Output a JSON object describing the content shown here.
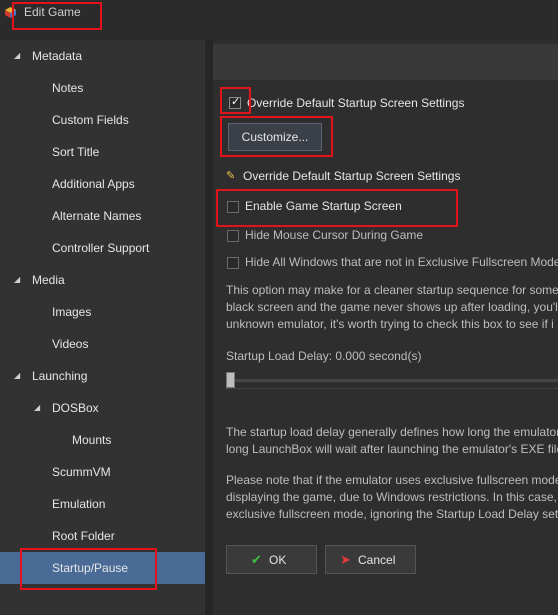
{
  "window": {
    "title": "Edit Game"
  },
  "sidebar": {
    "items": [
      {
        "label": "Metadata",
        "level": 0,
        "expanded": true
      },
      {
        "label": "Notes",
        "level": 1
      },
      {
        "label": "Custom Fields",
        "level": 1
      },
      {
        "label": "Sort Title",
        "level": 1
      },
      {
        "label": "Additional Apps",
        "level": 1
      },
      {
        "label": "Alternate Names",
        "level": 1
      },
      {
        "label": "Controller Support",
        "level": 1
      },
      {
        "label": "Media",
        "level": 0,
        "expanded": true
      },
      {
        "label": "Images",
        "level": 1
      },
      {
        "label": "Videos",
        "level": 1
      },
      {
        "label": "Launching",
        "level": 0,
        "expanded": true
      },
      {
        "label": "DOSBox",
        "level": 1,
        "expanded": true
      },
      {
        "label": "Mounts",
        "level": 2
      },
      {
        "label": "ScummVM",
        "level": 1
      },
      {
        "label": "Emulation",
        "level": 1
      },
      {
        "label": "Root Folder",
        "level": 1
      },
      {
        "label": "Startup/Pause",
        "level": 1,
        "selected": true
      }
    ]
  },
  "content": {
    "override_label": "Override Default Startup Screen Settings",
    "override_checked": true,
    "customize_label": "Customize...",
    "override_label2": "Override Default Startup Screen Settings",
    "enable_label": "Enable Game Startup Screen",
    "enable_checked": false,
    "hide_cursor_label": "Hide Mouse Cursor During Game",
    "hide_cursor_checked": false,
    "hide_windows_label": "Hide All Windows that are not in Exclusive Fullscreen Mode",
    "hide_windows_checked": false,
    "para1": [
      "This option may make for a cleaner startup sequence for some",
      "black screen and the game never shows up after loading, you'll",
      "unknown emulator, it's worth trying to check this box to see if i"
    ],
    "delay_label": "Startup Load Delay: 0.000 second(s)",
    "delay_value": 0,
    "para2": [
      "The startup load delay generally defines how long the emulator",
      "long LaunchBox will wait after launching the emulator's EXE file"
    ],
    "para3": [
      "Please note that if the emulator uses exclusive fullscreen mode,",
      "displaying the game, due to Windows restrictions. In this case,",
      "exclusive fullscreen mode, ignoring the Startup Load Delay sett"
    ],
    "ok_label": "OK",
    "cancel_label": "Cancel"
  },
  "colors": {
    "highlight": "#e2141b",
    "selected": "#4a6b96",
    "ok": "#3fbf3f",
    "cancel": "#e23a3a"
  }
}
